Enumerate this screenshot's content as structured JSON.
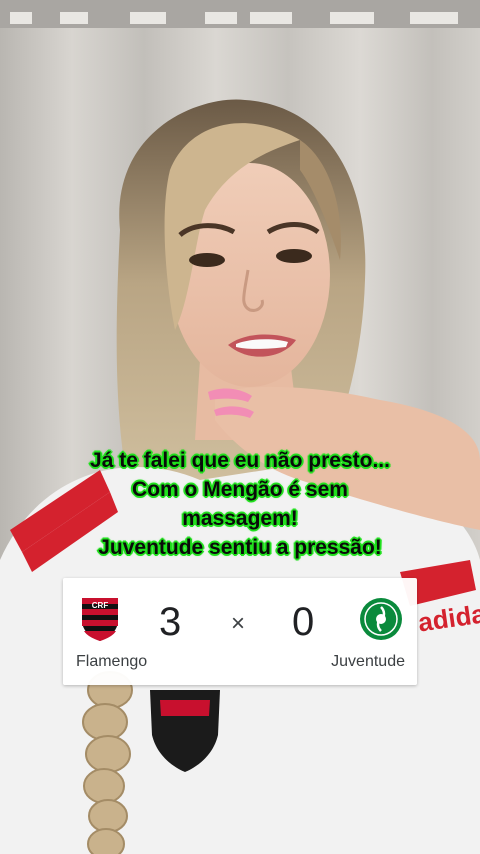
{
  "caption": {
    "lines": [
      "Já te falei que eu não presto...",
      "Com o Mengão é sem",
      "massagem!",
      "Juventude sentiu a pressão!"
    ],
    "text_color": "#0a0a0a",
    "glow_color": "#22e01f"
  },
  "scoreboard": {
    "home": {
      "name": "Flamengo",
      "score": "3",
      "crest_icon": "flamengo-crest-icon",
      "colors": [
        "#c8102e",
        "#111111"
      ]
    },
    "separator": "×",
    "away": {
      "name": "Juventude",
      "score": "0",
      "crest_icon": "juventude-crest-icon",
      "colors": [
        "#0a8a3c",
        "#ffffff"
      ]
    }
  }
}
